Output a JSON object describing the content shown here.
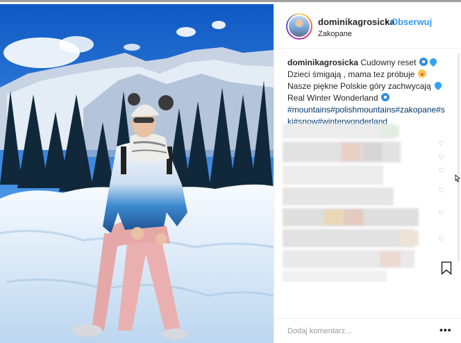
{
  "post": {
    "username": "dominikagrosicka",
    "separator": "•",
    "follow_label": "Obserwuj",
    "location": "Zakopane"
  },
  "caption": {
    "username": "dominikagrosicka",
    "line1": "Cudowny reset",
    "line2": "Dzieci śmigają , mama tez próbuje",
    "line3": "Nasze piękne Polskie góry zachwycają",
    "line4": "Real Winter Wonderland",
    "hashtags": "#mountains#polishmountains#zakopane#ski#snow#winterwonderland"
  },
  "comment_box": {
    "placeholder": "Dodaj komentarz..."
  },
  "icons": {
    "like": "heart-icon",
    "save": "bookmark-icon",
    "more": "more-options-icon"
  },
  "colors": {
    "link": "#3897f0",
    "hashtag": "#003569",
    "text": "#262626"
  }
}
